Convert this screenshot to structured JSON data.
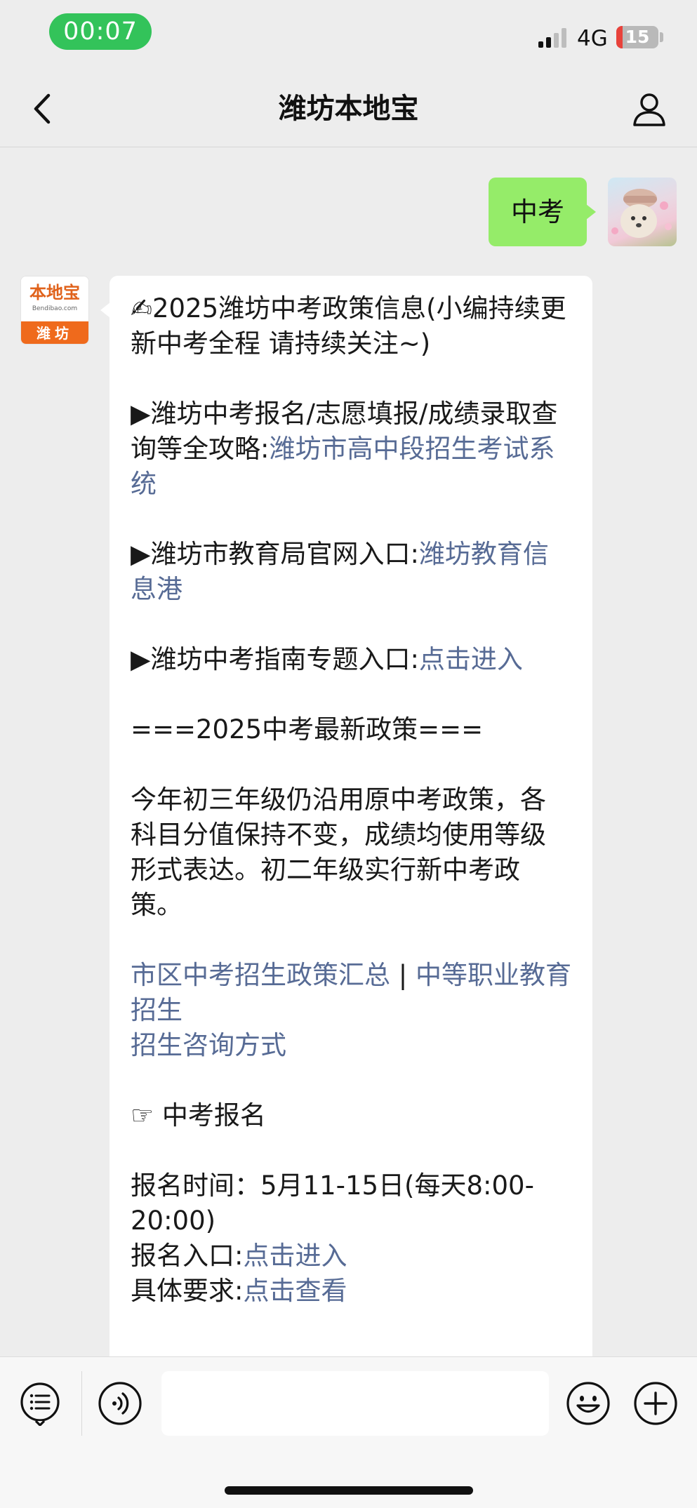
{
  "status_bar": {
    "time": "00:07",
    "network": "4G",
    "battery": 15,
    "battery_label": "15"
  },
  "nav": {
    "title": "潍坊本地宝",
    "back_icon": "chevron-left-icon",
    "profile_icon": "person-icon"
  },
  "chat": {
    "sent_message": "中考",
    "bot_logo": {
      "name": "本地宝",
      "site": "Bendibao.com",
      "city": "潍坊"
    },
    "reply": {
      "intro": "✍2025潍坊中考政策信息(小编持续更新中考全程 请持续关注~)",
      "item1_text": "▶潍坊中考报名/志愿填报/成绩录取查询等全攻略:",
      "item1_link": "潍坊市高中段招生考试系统",
      "item2_text": "▶潍坊市教育局官网入口:",
      "item2_link": "潍坊教育信息港",
      "item3_text": "▶潍坊中考指南专题入口:",
      "item3_link": "点击进入",
      "section_title": "===2025中考最新政策===",
      "policy_text": "今年初三年级仍沿用原中考政策，各科目分值保持不变，成绩均使用等级形式表达。初二年级实行新中考政策。",
      "link_policy_summary": "市区中考招生政策汇总",
      "link_separator": " | ",
      "link_vocational": "中等职业教育招生",
      "link_consult": "招生咨询方式",
      "signup_heading": "☞ 中考报名",
      "signup_time": "报名时间：5月11-15日(每天8:00-20:00)",
      "signup_entry_label": "报名入口:",
      "signup_entry_link": "点击进入",
      "requirements_label": "具体要求:",
      "requirements_link": "点击查看"
    }
  },
  "input_bar": {
    "menu_icon": "list-menu-icon",
    "voice_icon": "voice-icon",
    "input_value": "",
    "emoji_icon": "smiley-icon",
    "plus_icon": "plus-circle-icon"
  },
  "colors": {
    "sent_bubble": "#95ec69",
    "link": "#576b95",
    "time_pill": "#33c35a",
    "battery_low": "#e8423b"
  }
}
